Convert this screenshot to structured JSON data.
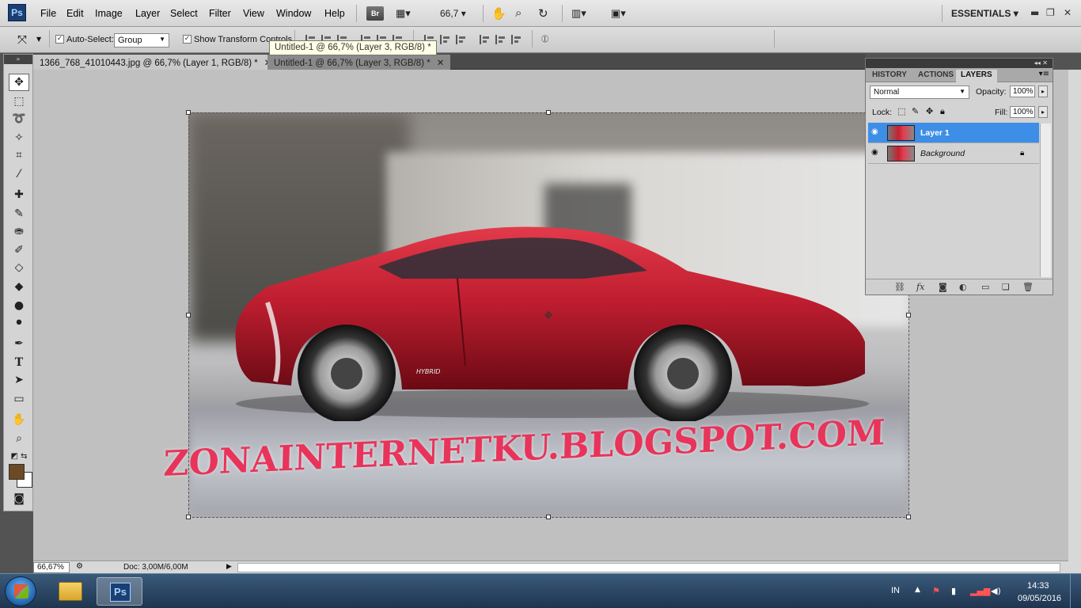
{
  "app": {
    "logo": "Ps"
  },
  "menu": [
    "File",
    "Edit",
    "Image",
    "Layer",
    "Select",
    "Filter",
    "View",
    "Window",
    "Help"
  ],
  "appbar": {
    "bridge": "Br",
    "zoom": "66,7",
    "workspace": "ESSENTIALS"
  },
  "options": {
    "auto_select_label": "Auto-Select:",
    "auto_select_value": "Group",
    "show_transform_label": "Show Transform Controls"
  },
  "tooltip": "Untitled-1 @ 66,7% (Layer 3, RGB/8) *",
  "tabs": [
    {
      "label": "1366_768_41010443.jpg @ 66,7% (Layer 1, RGB/8) *"
    },
    {
      "label": "Untitled-1 @ 66,7% (Layer 3, RGB/8) *"
    }
  ],
  "canvas": {
    "watermark": "ZONAINTERNETKU.BLOGSPOT.COM",
    "badge": "HYBRID"
  },
  "status": {
    "zoom": "66,67%",
    "doc": "Doc: 3,00M/6,00M"
  },
  "layers_panel": {
    "tabs": [
      "HISTORY",
      "ACTIONS",
      "LAYERS"
    ],
    "blend_mode": "Normal",
    "opacity_label": "Opacity:",
    "opacity": "100%",
    "lock_label": "Lock:",
    "fill_label": "Fill:",
    "fill": "100%",
    "layers": [
      {
        "name": "Layer 1",
        "selected": true
      },
      {
        "name": "Background",
        "selected": false
      }
    ]
  },
  "taskbar": {
    "lang": "IN",
    "time": "14:33",
    "date": "09/05/2016"
  },
  "colors": {
    "selection": "#3d8ee6",
    "watermark": "#e8345a",
    "car": "#c01e30",
    "foreground": "#6b4a24"
  }
}
